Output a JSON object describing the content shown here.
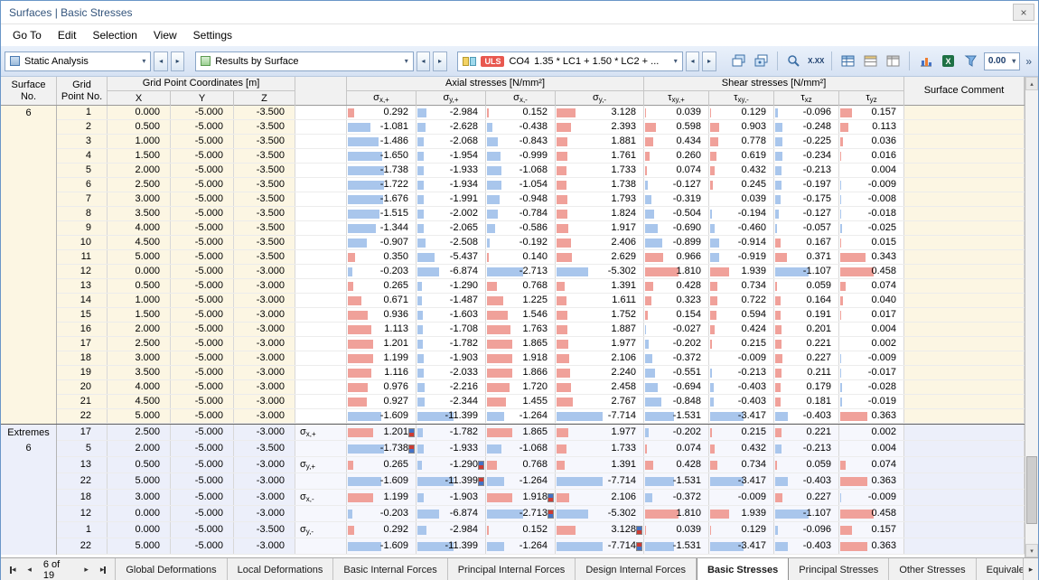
{
  "window": {
    "title": "Surfaces | Basic Stresses",
    "close_icon": "×"
  },
  "menu": {
    "items": [
      "Go To",
      "Edit",
      "Selection",
      "View",
      "Settings"
    ]
  },
  "icons": {
    "dropdown": "▾",
    "prev": "◂",
    "next": "▸",
    "scroll_up": "▴",
    "scroll_down": "▾",
    "scroll_right": "▸"
  },
  "toolbar": {
    "analysis": {
      "value": "Static Analysis"
    },
    "results": {
      "value": "Results by Surface"
    },
    "combo": {
      "badge": "ULS",
      "name": "CO4",
      "formula": "1.35 * LC1 + 1.50 * LC2 + ...",
      "badge_color": "#e8584f"
    },
    "decimal_icon_label": "X.XX",
    "decimals": "0.00",
    "overflow": "»"
  },
  "table": {
    "headers": {
      "surface_l1": "Surface",
      "surface_l2": "No.",
      "grid_l1": "Grid",
      "grid_l2": "Point No.",
      "coords_group": "Grid Point Coordinates [m]",
      "coord_cols": [
        "X",
        "Y",
        "Z"
      ],
      "axial_group": "Axial stresses [N/mm²]",
      "axial_cols": [
        {
          "base": "σ",
          "sub": "x,+"
        },
        {
          "base": "σ",
          "sub": "y,+"
        },
        {
          "base": "σ",
          "sub": "x,-"
        },
        {
          "base": "σ",
          "sub": "y,-"
        }
      ],
      "shear_group": "Shear stresses [N/mm²]",
      "shear_cols": [
        {
          "base": "τ",
          "sub": "xy,+"
        },
        {
          "base": "τ",
          "sub": "xy,-"
        },
        {
          "base": "τ",
          "sub": "xz"
        },
        {
          "base": "τ",
          "sub": "yz"
        }
      ],
      "comment": "Surface Comment"
    },
    "bar_colors": {
      "positive": "#f0a19a",
      "negative": "#a9c6ec"
    },
    "main": {
      "surface_no": "6",
      "rows": [
        {
          "no": "1",
          "x": "0.000",
          "y": "-5.000",
          "z": "-3.500",
          "v": [
            "0.292",
            "-2.984",
            "0.152",
            "3.128",
            "0.039",
            "0.129",
            "-0.096",
            "0.157"
          ]
        },
        {
          "no": "2",
          "x": "0.500",
          "y": "-5.000",
          "z": "-3.500",
          "v": [
            "-1.081",
            "-2.628",
            "-0.438",
            "2.393",
            "0.598",
            "0.903",
            "-0.248",
            "0.113"
          ]
        },
        {
          "no": "3",
          "x": "1.000",
          "y": "-5.000",
          "z": "-3.500",
          "v": [
            "-1.486",
            "-2.068",
            "-0.843",
            "1.881",
            "0.434",
            "0.778",
            "-0.225",
            "0.036"
          ]
        },
        {
          "no": "4",
          "x": "1.500",
          "y": "-5.000",
          "z": "-3.500",
          "v": [
            "-1.650",
            "-1.954",
            "-0.999",
            "1.761",
            "0.260",
            "0.619",
            "-0.234",
            "0.016"
          ]
        },
        {
          "no": "5",
          "x": "2.000",
          "y": "-5.000",
          "z": "-3.500",
          "v": [
            "-1.738",
            "-1.933",
            "-1.068",
            "1.733",
            "0.074",
            "0.432",
            "-0.213",
            "0.004"
          ]
        },
        {
          "no": "6",
          "x": "2.500",
          "y": "-5.000",
          "z": "-3.500",
          "v": [
            "-1.722",
            "-1.934",
            "-1.054",
            "1.738",
            "-0.127",
            "0.245",
            "-0.197",
            "-0.009"
          ]
        },
        {
          "no": "7",
          "x": "3.000",
          "y": "-5.000",
          "z": "-3.500",
          "v": [
            "-1.676",
            "-1.991",
            "-0.948",
            "1.793",
            "-0.319",
            "0.039",
            "-0.175",
            "-0.008"
          ]
        },
        {
          "no": "8",
          "x": "3.500",
          "y": "-5.000",
          "z": "-3.500",
          "v": [
            "-1.515",
            "-2.002",
            "-0.784",
            "1.824",
            "-0.504",
            "-0.194",
            "-0.127",
            "-0.018"
          ]
        },
        {
          "no": "9",
          "x": "4.000",
          "y": "-5.000",
          "z": "-3.500",
          "v": [
            "-1.344",
            "-2.065",
            "-0.586",
            "1.917",
            "-0.690",
            "-0.460",
            "-0.057",
            "-0.025"
          ]
        },
        {
          "no": "10",
          "x": "4.500",
          "y": "-5.000",
          "z": "-3.500",
          "v": [
            "-0.907",
            "-2.508",
            "-0.192",
            "2.406",
            "-0.899",
            "-0.914",
            "0.167",
            "0.015"
          ]
        },
        {
          "no": "11",
          "x": "5.000",
          "y": "-5.000",
          "z": "-3.500",
          "v": [
            "0.350",
            "-5.437",
            "0.140",
            "2.629",
            "0.966",
            "-0.919",
            "0.371",
            "0.343"
          ]
        },
        {
          "no": "12",
          "x": "0.000",
          "y": "-5.000",
          "z": "-3.000",
          "v": [
            "-0.203",
            "-6.874",
            "-2.713",
            "-5.302",
            "1.810",
            "1.939",
            "-1.107",
            "0.458"
          ]
        },
        {
          "no": "13",
          "x": "0.500",
          "y": "-5.000",
          "z": "-3.000",
          "v": [
            "0.265",
            "-1.290",
            "0.768",
            "1.391",
            "0.428",
            "0.734",
            "0.059",
            "0.074"
          ]
        },
        {
          "no": "14",
          "x": "1.000",
          "y": "-5.000",
          "z": "-3.000",
          "v": [
            "0.671",
            "-1.487",
            "1.225",
            "1.611",
            "0.323",
            "0.722",
            "0.164",
            "0.040"
          ]
        },
        {
          "no": "15",
          "x": "1.500",
          "y": "-5.000",
          "z": "-3.000",
          "v": [
            "0.936",
            "-1.603",
            "1.546",
            "1.752",
            "0.154",
            "0.594",
            "0.191",
            "0.017"
          ]
        },
        {
          "no": "16",
          "x": "2.000",
          "y": "-5.000",
          "z": "-3.000",
          "v": [
            "1.113",
            "-1.708",
            "1.763",
            "1.887",
            "-0.027",
            "0.424",
            "0.201",
            "0.004"
          ]
        },
        {
          "no": "17",
          "x": "2.500",
          "y": "-5.000",
          "z": "-3.000",
          "v": [
            "1.201",
            "-1.782",
            "1.865",
            "1.977",
            "-0.202",
            "0.215",
            "0.221",
            "0.002"
          ]
        },
        {
          "no": "18",
          "x": "3.000",
          "y": "-5.000",
          "z": "-3.000",
          "v": [
            "1.199",
            "-1.903",
            "1.918",
            "2.106",
            "-0.372",
            "-0.009",
            "0.227",
            "-0.009"
          ]
        },
        {
          "no": "19",
          "x": "3.500",
          "y": "-5.000",
          "z": "-3.000",
          "v": [
            "1.116",
            "-2.033",
            "1.866",
            "2.240",
            "-0.551",
            "-0.213",
            "0.211",
            "-0.017"
          ]
        },
        {
          "no": "20",
          "x": "4.000",
          "y": "-5.000",
          "z": "-3.000",
          "v": [
            "0.976",
            "-2.216",
            "1.720",
            "2.458",
            "-0.694",
            "-0.403",
            "0.179",
            "-0.028"
          ]
        },
        {
          "no": "21",
          "x": "4.500",
          "y": "-5.000",
          "z": "-3.000",
          "v": [
            "0.927",
            "-2.344",
            "1.455",
            "2.767",
            "-0.848",
            "-0.403",
            "0.181",
            "-0.019"
          ]
        },
        {
          "no": "22",
          "x": "5.000",
          "y": "-5.000",
          "z": "-3.000",
          "v": [
            "-1.609",
            "-11.399",
            "-1.264",
            "-7.714",
            "-1.531",
            "-3.417",
            "-0.403",
            "0.363"
          ]
        }
      ]
    },
    "extremes": {
      "label": "Extremes",
      "surface_no": "6",
      "rows": [
        {
          "no": "17",
          "x": "2.500",
          "y": "-5.000",
          "z": "-3.000",
          "label": {
            "base": "σ",
            "sub": "x,+"
          },
          "marker_col": 0,
          "marker_type": "max",
          "v": [
            "1.201",
            "-1.782",
            "1.865",
            "1.977",
            "-0.202",
            "0.215",
            "0.221",
            "0.002"
          ]
        },
        {
          "no": "5",
          "x": "2.000",
          "y": "-5.000",
          "z": "-3.500",
          "label": null,
          "marker_col": 0,
          "marker_type": "min",
          "v": [
            "-1.738",
            "-1.933",
            "-1.068",
            "1.733",
            "0.074",
            "0.432",
            "-0.213",
            "0.004"
          ]
        },
        {
          "no": "13",
          "x": "0.500",
          "y": "-5.000",
          "z": "-3.000",
          "label": {
            "base": "σ",
            "sub": "y,+"
          },
          "marker_col": 1,
          "marker_type": "max",
          "v": [
            "0.265",
            "-1.290",
            "0.768",
            "1.391",
            "0.428",
            "0.734",
            "0.059",
            "0.074"
          ]
        },
        {
          "no": "22",
          "x": "5.000",
          "y": "-5.000",
          "z": "-3.000",
          "label": null,
          "marker_col": 1,
          "marker_type": "min",
          "v": [
            "-1.609",
            "-11.399",
            "-1.264",
            "-7.714",
            "-1.531",
            "-3.417",
            "-0.403",
            "0.363"
          ]
        },
        {
          "no": "18",
          "x": "3.000",
          "y": "-5.000",
          "z": "-3.000",
          "label": {
            "base": "σ",
            "sub": "x,-"
          },
          "marker_col": 2,
          "marker_type": "max",
          "v": [
            "1.199",
            "-1.903",
            "1.918",
            "2.106",
            "-0.372",
            "-0.009",
            "0.227",
            "-0.009"
          ]
        },
        {
          "no": "12",
          "x": "0.000",
          "y": "-5.000",
          "z": "-3.000",
          "label": null,
          "marker_col": 2,
          "marker_type": "min",
          "v": [
            "-0.203",
            "-6.874",
            "-2.713",
            "-5.302",
            "1.810",
            "1.939",
            "-1.107",
            "0.458"
          ]
        },
        {
          "no": "1",
          "x": "0.000",
          "y": "-5.000",
          "z": "-3.500",
          "label": {
            "base": "σ",
            "sub": "y,-"
          },
          "marker_col": 3,
          "marker_type": "max",
          "v": [
            "0.292",
            "-2.984",
            "0.152",
            "3.128",
            "0.039",
            "0.129",
            "-0.096",
            "0.157"
          ]
        },
        {
          "no": "22",
          "x": "5.000",
          "y": "-5.000",
          "z": "-3.000",
          "label": null,
          "marker_col": 3,
          "marker_type": "min",
          "v": [
            "-1.609",
            "-11.399",
            "-1.264",
            "-7.714",
            "-1.531",
            "-3.417",
            "-0.403",
            "0.363"
          ]
        }
      ]
    }
  },
  "bottombar": {
    "nav_label": "6 of 19",
    "tabs": [
      {
        "label": "Global Deformations",
        "active": false
      },
      {
        "label": "Local Deformations",
        "active": false
      },
      {
        "label": "Basic Internal Forces",
        "active": false
      },
      {
        "label": "Principal Internal Forces",
        "active": false
      },
      {
        "label": "Design Internal Forces",
        "active": false
      },
      {
        "label": "Basic Stresses",
        "active": true
      },
      {
        "label": "Principal Stresses",
        "active": false
      },
      {
        "label": "Other Stresses",
        "active": false
      },
      {
        "label": "Equivalent Stre",
        "active": false
      }
    ]
  }
}
